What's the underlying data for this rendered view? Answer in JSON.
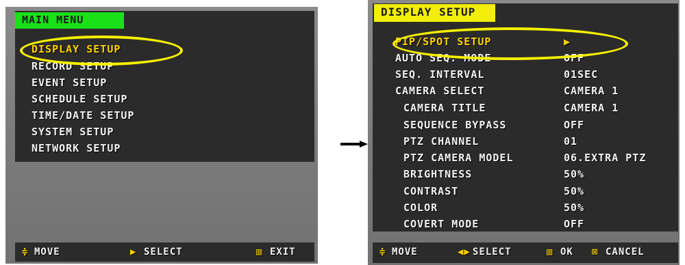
{
  "main_menu": {
    "title": "MAIN MENU",
    "items": [
      "DISPLAY SETUP",
      "RECORD SETUP",
      "EVENT SETUP",
      "SCHEDULE SETUP",
      "TIME/DATE SETUP",
      "SYSTEM SETUP",
      "NETWORK SETUP"
    ],
    "footer": {
      "move_icon": "≑",
      "move": "MOVE",
      "select_icon": "▶",
      "select": "SELECT",
      "exit_icon": "▥",
      "exit": "EXIT"
    }
  },
  "display_setup": {
    "title": "DISPLAY SETUP",
    "rows": [
      {
        "label": "PIP/SPOT SETUP",
        "value": "▶"
      },
      {
        "label": "AUTO SEQ. MODE",
        "value": "OFF"
      },
      {
        "label": "SEQ. INTERVAL",
        "value": "01SEC"
      },
      {
        "label": "CAMERA SELECT",
        "value": "CAMERA 1"
      },
      {
        "label": "CAMERA TITLE",
        "value": "CAMERA 1"
      },
      {
        "label": "SEQUENCE BYPASS",
        "value": "OFF"
      },
      {
        "label": "PTZ CHANNEL",
        "value": "01"
      },
      {
        "label": "PTZ CAMERA MODEL",
        "value": "06.EXTRA PTZ"
      },
      {
        "label": "BRIGHTNESS",
        "value": "50%"
      },
      {
        "label": "CONTRAST",
        "value": "50%"
      },
      {
        "label": "COLOR",
        "value": "50%"
      },
      {
        "label": "COVERT MODE",
        "value": "OFF"
      }
    ],
    "footer": {
      "move_icon": "≑",
      "move": "MOVE",
      "select_icon": "◀▶",
      "select": "SELECT",
      "ok_icon": "▥",
      "ok": "OK",
      "cancel_icon": "⊠",
      "cancel": "CANCEL"
    }
  },
  "colors": {
    "main_title_bg": "#19e019",
    "display_title_bg": "#f2ee0a",
    "highlight_ellipse": "#f5f000"
  }
}
